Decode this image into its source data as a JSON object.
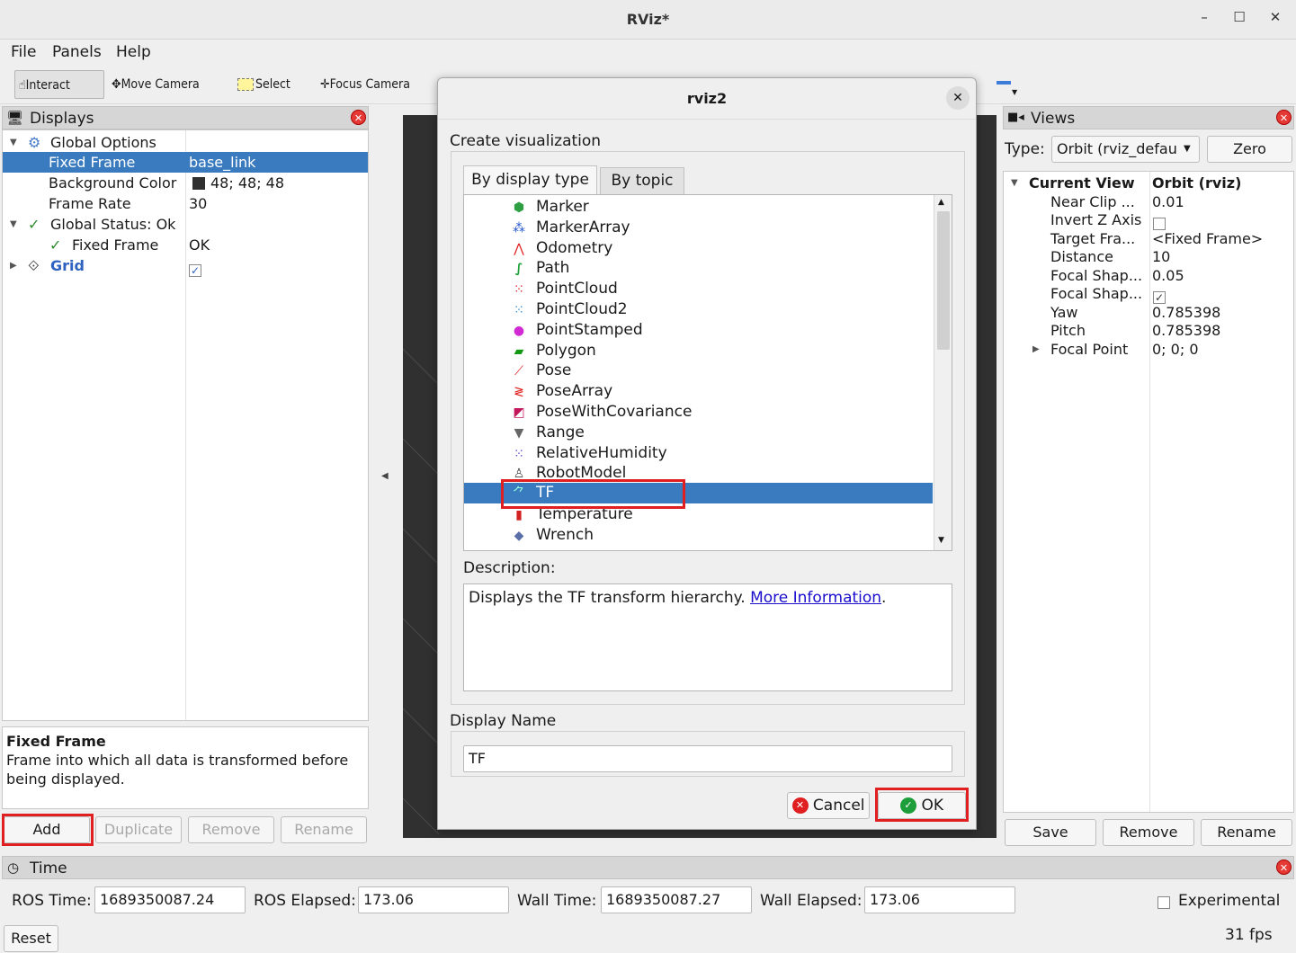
{
  "window": {
    "title": "RViz*"
  },
  "menu": [
    "File",
    "Panels",
    "Help"
  ],
  "toolbar": {
    "interact": "Interact",
    "move_camera": "Move Camera",
    "select": "Select",
    "focus_camera": "Focus Camera"
  },
  "displays": {
    "title": "Displays",
    "rows": {
      "global_options": "Global Options",
      "fixed_frame_label": "Fixed Frame",
      "fixed_frame_value": "base_link",
      "bg_label": "Background Color",
      "bg_value": "48; 48; 48",
      "rate_label": "Frame Rate",
      "rate_value": "30",
      "status_label": "Global Status: Ok",
      "status_fixed_label": "Fixed Frame",
      "status_fixed_value": "OK",
      "grid_label": "Grid"
    },
    "desc_title": "Fixed Frame",
    "desc_text": "Frame into which all data is transformed before being displayed.",
    "buttons": {
      "add": "Add",
      "duplicate": "Duplicate",
      "remove": "Remove",
      "rename": "Rename"
    }
  },
  "dialog": {
    "title": "rviz2",
    "heading": "Create visualization",
    "tabs": {
      "by_display_type": "By display type",
      "by_topic": "By topic"
    },
    "items": [
      "Marker",
      "MarkerArray",
      "Odometry",
      "Path",
      "PointCloud",
      "PointCloud2",
      "PointStamped",
      "Polygon",
      "Pose",
      "PoseArray",
      "PoseWithCovariance",
      "Range",
      "RelativeHumidity",
      "RobotModel",
      "TF",
      "Temperature",
      "Wrench"
    ],
    "selected": "TF",
    "description_label": "Description:",
    "description_text": "Displays the TF transform hierarchy.",
    "more_info": "More Information",
    "description_end": ".",
    "display_name_label": "Display Name",
    "display_name_value": "TF",
    "cancel": "Cancel",
    "ok": "OK"
  },
  "views": {
    "title": "Views",
    "type_label": "Type:",
    "type_value": "Orbit (rviz_defau",
    "zero": "Zero",
    "current_view": "Current View",
    "current_view_value": "Orbit (rviz)",
    "props": [
      {
        "k": "Near Clip ...",
        "v": "0.01"
      },
      {
        "k": "Invert Z Axis",
        "v": ""
      },
      {
        "k": "Target Fra...",
        "v": "<Fixed Frame>"
      },
      {
        "k": "Distance",
        "v": "10"
      },
      {
        "k": "Focal Shap...",
        "v": "0.05"
      },
      {
        "k": "Focal Shap...",
        "v": ""
      },
      {
        "k": "Yaw",
        "v": "0.785398"
      },
      {
        "k": "Pitch",
        "v": "0.785398"
      },
      {
        "k": "Focal Point",
        "v": "0; 0; 0"
      }
    ],
    "buttons": {
      "save": "Save",
      "remove": "Remove",
      "rename": "Rename"
    }
  },
  "time": {
    "title": "Time",
    "ros_time_label": "ROS Time:",
    "ros_time": "1689350087.24",
    "ros_elapsed_label": "ROS Elapsed:",
    "ros_elapsed": "173.06",
    "wall_time_label": "Wall Time:",
    "wall_time": "1689350087.27",
    "wall_elapsed_label": "Wall Elapsed:",
    "wall_elapsed": "173.06",
    "experimental": "Experimental",
    "reset": "Reset",
    "fps": "31 fps"
  }
}
